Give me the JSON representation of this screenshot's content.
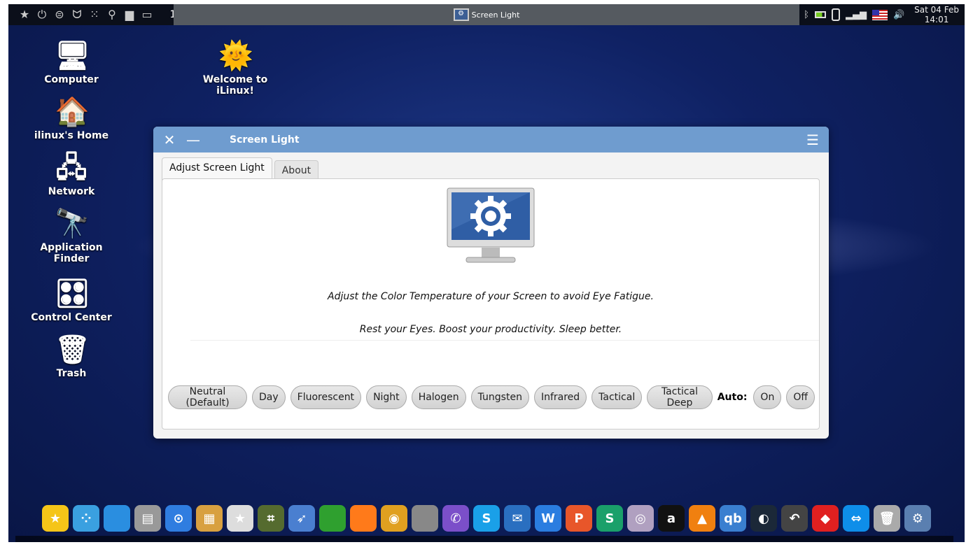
{
  "topbar": {
    "left_icons": [
      "star-icon",
      "power-icon",
      "toggle-icon",
      "binoculars-icon",
      "apps-icon",
      "search-icon",
      "folder-icon",
      "window-icon"
    ],
    "workspace": "1",
    "task_title": "Screen Light",
    "tray_icons": [
      "bluetooth-icon",
      "battery-icon",
      "clipboard-icon",
      "signal-icon",
      "us-flag-icon",
      "volume-icon"
    ],
    "clock_date": "Sat 04 Feb",
    "clock_time": "14:01"
  },
  "desktop_icons": [
    {
      "label": "Computer",
      "icon": "🖥"
    },
    {
      "label": "Welcome to iLinux!",
      "icon": "🌞"
    },
    {
      "label": "ilinux's Home",
      "icon": "🏠"
    },
    {
      "label": "Network",
      "icon": "🖧"
    },
    {
      "label": "Application Finder",
      "icon": "🔭"
    },
    {
      "label": "Control Center",
      "icon": "🎛"
    },
    {
      "label": "Trash",
      "icon": "🗑"
    }
  ],
  "window": {
    "title": "Screen Light",
    "tabs": [
      "Adjust Screen Light",
      "About"
    ],
    "line1": "Adjust the Color Temperature of your Screen to avoid Eye Fatigue.",
    "line2": "Rest your Eyes. Boost your productivity. Sleep better.",
    "presets": [
      "Neutral (Default)",
      "Day",
      "Fluorescent",
      "Night",
      "Halogen",
      "Tungsten",
      "Infrared",
      "Tactical",
      "Tactical Deep"
    ],
    "auto_label": "Auto:",
    "auto_on": "On",
    "auto_off": "Off",
    "accent": "#6f9ccf"
  },
  "dock": [
    {
      "name": "favorites",
      "c": "#f5c518",
      "t": "★"
    },
    {
      "name": "apps",
      "c": "#3aa0e0",
      "t": "⁘"
    },
    {
      "name": "desktop",
      "c": "#2a8ee0",
      "t": ""
    },
    {
      "name": "files",
      "c": "#999",
      "t": "▤"
    },
    {
      "name": "control-center",
      "c": "#2f7de0",
      "t": "⊙"
    },
    {
      "name": "palette",
      "c": "#d8a040",
      "t": "▦"
    },
    {
      "name": "store",
      "c": "#ddd",
      "t": "★"
    },
    {
      "name": "finder",
      "c": "#556b2f",
      "t": "⌗"
    },
    {
      "name": "rocket",
      "c": "#4a7fd0",
      "t": "➶"
    },
    {
      "name": "pipe",
      "c": "#2fa02f",
      "t": ""
    },
    {
      "name": "firefox",
      "c": "#ff7a1a",
      "t": ""
    },
    {
      "name": "chrome",
      "c": "#e0a020",
      "t": "◉"
    },
    {
      "name": "earth-pro",
      "c": "#888",
      "t": ""
    },
    {
      "name": "viber",
      "c": "#7b4fc9",
      "t": "✆"
    },
    {
      "name": "skype",
      "c": "#1aa0e8",
      "t": "S"
    },
    {
      "name": "mail",
      "c": "#2a6fc0",
      "t": "✉"
    },
    {
      "name": "wps-writer",
      "c": "#2a7de0",
      "t": "W"
    },
    {
      "name": "wps-presentation",
      "c": "#e8562a",
      "t": "P"
    },
    {
      "name": "wps-spreadsheet",
      "c": "#1aa06a",
      "t": "S"
    },
    {
      "name": "webcam",
      "c": "#b0a0c0",
      "t": "◎"
    },
    {
      "name": "anydesk-a",
      "c": "#111",
      "t": "a"
    },
    {
      "name": "vlc",
      "c": "#f08010",
      "t": "▲"
    },
    {
      "name": "qbittorrent",
      "c": "#3a7fd0",
      "t": "qb"
    },
    {
      "name": "steam",
      "c": "#1b2838",
      "t": "◐"
    },
    {
      "name": "timeshift",
      "c": "#444",
      "t": "↶"
    },
    {
      "name": "anydesk",
      "c": "#e02020",
      "t": "◆"
    },
    {
      "name": "teamviewer",
      "c": "#0e8ee9",
      "t": "⇔"
    },
    {
      "name": "trash",
      "c": "#aaa",
      "t": "🗑"
    },
    {
      "name": "screen-light",
      "c": "#5a7fb0",
      "t": "⚙"
    }
  ]
}
